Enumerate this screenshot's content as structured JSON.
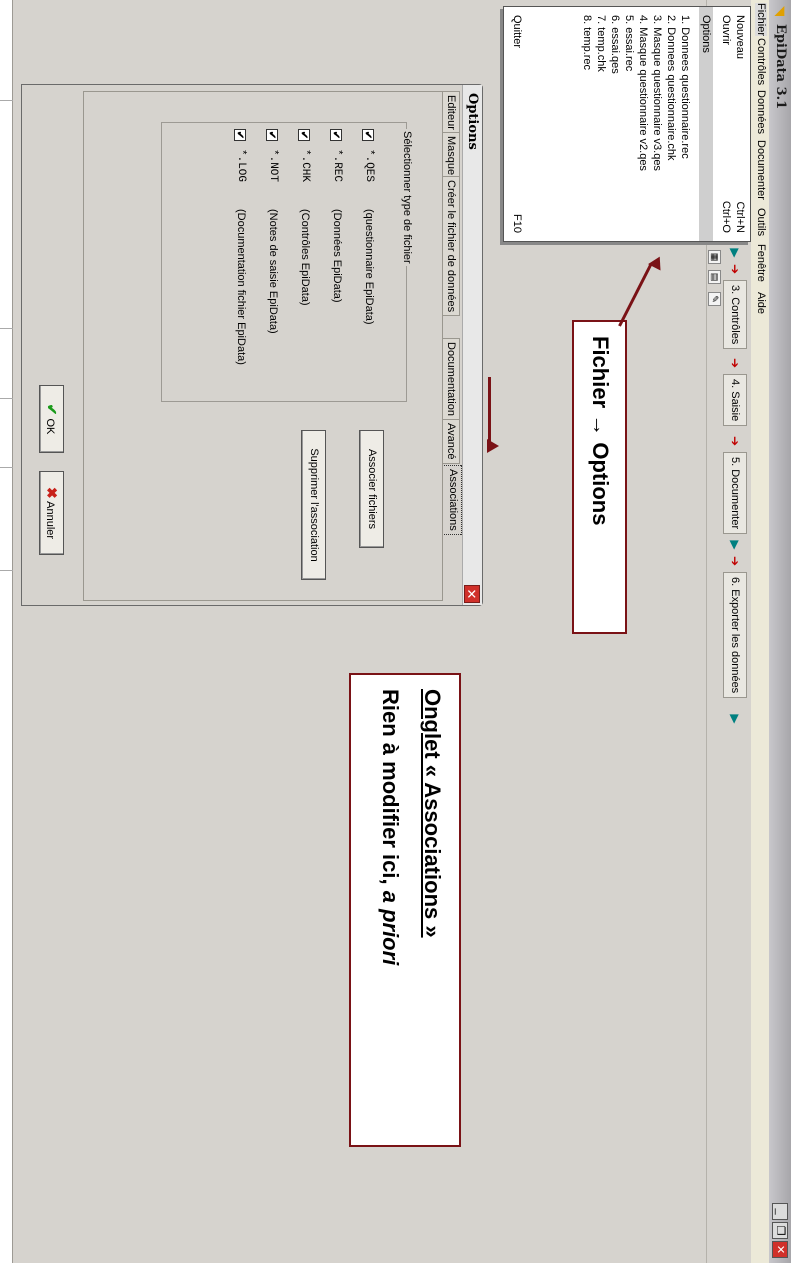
{
  "window": {
    "title": "EpiData 3.1",
    "minimize_label": "_",
    "restore_label": "❐",
    "close_label": "✕"
  },
  "menubar": {
    "items": [
      "Fichier",
      "Contrôles",
      "Données",
      "Documenter",
      "Outils",
      "Fenêtre",
      "Aide"
    ]
  },
  "toolbar": {
    "steps": [
      {
        "label": "3. Contrôles"
      },
      {
        "label": "4. Saisie"
      },
      {
        "label": "5. Documenter"
      },
      {
        "label": "6. Exporter les données"
      }
    ]
  },
  "file_menu": {
    "items": [
      {
        "label": "Nouveau",
        "shortcut": "Ctrl+N"
      },
      {
        "label": "Ouvrir",
        "shortcut": "Ctrl+O"
      },
      {
        "label": "Options",
        "shortcut": ""
      },
      {
        "label": "1. Donnees questionnaire.rec",
        "shortcut": ""
      },
      {
        "label": "2. Donnees questionnaire.chk",
        "shortcut": ""
      },
      {
        "label": "3. Masque questionnaire v3.qes",
        "shortcut": ""
      },
      {
        "label": "4. Masque questionnaire v2.qes",
        "shortcut": ""
      },
      {
        "label": "5. essai.rec",
        "shortcut": ""
      },
      {
        "label": "6. essai.qes",
        "shortcut": ""
      },
      {
        "label": "7. temp.chk",
        "shortcut": ""
      },
      {
        "label": "8. temp.rec",
        "shortcut": ""
      },
      {
        "label": "Quitter",
        "shortcut": "F10"
      }
    ]
  },
  "options_dialog": {
    "title": "Options",
    "close_label": "✕",
    "tabs": [
      "Editeur",
      "Masque",
      "Créer le fichier de données",
      "Documentation",
      "Avancé",
      "Associations"
    ],
    "active_tab": "Associations",
    "group_label": "Sélectionner type de fichier",
    "file_types": [
      {
        "ext": "*.QES",
        "desc": "(questionnaire EpiData)",
        "checked": true
      },
      {
        "ext": "*.REC",
        "desc": "(Données EpiData)",
        "checked": true
      },
      {
        "ext": "*.CHK",
        "desc": "(Contrôles EpiData)",
        "checked": true
      },
      {
        "ext": "*.NOT",
        "desc": "(Notes de saisie EpiData)",
        "checked": true
      },
      {
        "ext": "*.LOG",
        "desc": "(Documentation fichier EpiData)",
        "checked": true
      }
    ],
    "associate_button": "Associer fichiers",
    "remove_button": "Supprimer l'association",
    "ok_button": "OK",
    "cancel_button": "Annuler"
  },
  "annotations": {
    "menu_path": "Fichier → Options",
    "heading": "Onglet « Associations »",
    "note_plain": "Rien à modifier ici, ",
    "note_italic": "a priori"
  },
  "colors": {
    "annotation_border": "#7a1216",
    "dialog_bg": "#d6d3ce",
    "check_ok": "#1a9a1a",
    "cancel_x": "#c8211a"
  }
}
